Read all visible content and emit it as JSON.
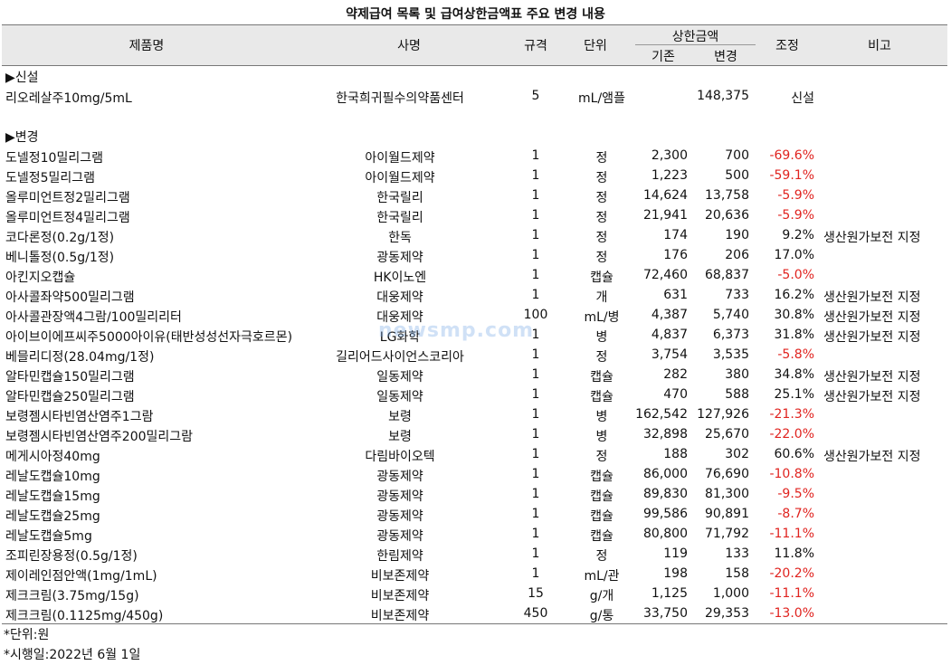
{
  "title": "약제급여 목록 및 급여상한금액표 주요 변경 내용",
  "header": {
    "product": "제품명",
    "company": "사명",
    "spec": "규격",
    "unit": "단위",
    "limit": "상한금액",
    "old": "기존",
    "new": "변경",
    "adj": "조정",
    "note": "비고"
  },
  "sections": {
    "new_label": "▶신설",
    "changed_label": "▶변경"
  },
  "new_rows": [
    {
      "name": "리오레살주10mg/5mL",
      "company": "한국희귀필수의약품센터",
      "spec": "5",
      "unit": "mL/앰플",
      "old": "",
      "new": "148,375",
      "adj": "신설",
      "note": ""
    }
  ],
  "rows": [
    {
      "name": "도넬정10밀리그램",
      "company": "아이월드제약",
      "spec": "1",
      "unit": "정",
      "old": "2,300",
      "new": "700",
      "adj": "-69.6%",
      "note": ""
    },
    {
      "name": "도넬정5밀리그램",
      "company": "아이월드제약",
      "spec": "1",
      "unit": "정",
      "old": "1,223",
      "new": "500",
      "adj": "-59.1%",
      "note": ""
    },
    {
      "name": "올루미언트정2밀리그램",
      "company": "한국릴리",
      "spec": "1",
      "unit": "정",
      "old": "14,624",
      "new": "13,758",
      "adj": "-5.9%",
      "note": ""
    },
    {
      "name": "올루미언트정4밀리그램",
      "company": "한국릴리",
      "spec": "1",
      "unit": "정",
      "old": "21,941",
      "new": "20,636",
      "adj": "-5.9%",
      "note": ""
    },
    {
      "name": "코다론정(0.2g/1정)",
      "company": "한독",
      "spec": "1",
      "unit": "정",
      "old": "174",
      "new": "190",
      "adj": "9.2%",
      "note": "생산원가보전 지정"
    },
    {
      "name": "베니톨정(0.5g/1정)",
      "company": "광동제약",
      "spec": "1",
      "unit": "정",
      "old": "176",
      "new": "206",
      "adj": "17.0%",
      "note": ""
    },
    {
      "name": "아킨지오캡슐",
      "company": "HK이노엔",
      "spec": "1",
      "unit": "캡슐",
      "old": "72,460",
      "new": "68,837",
      "adj": "-5.0%",
      "note": ""
    },
    {
      "name": "아사콜좌약500밀리그램",
      "company": "대웅제약",
      "spec": "1",
      "unit": "개",
      "old": "631",
      "new": "733",
      "adj": "16.2%",
      "note": "생산원가보전 지정"
    },
    {
      "name": "아사콜관장액4그람/100밀리리터",
      "company": "대웅제약",
      "spec": "100",
      "unit": "mL/병",
      "old": "4,387",
      "new": "5,740",
      "adj": "30.8%",
      "note": "생산원가보전 지정"
    },
    {
      "name": "아이브이에프씨주5000아이유(태반성성선자극호르몬)",
      "company": "LG화학",
      "spec": "1",
      "unit": "병",
      "old": "4,837",
      "new": "6,373",
      "adj": "31.8%",
      "note": "생산원가보전 지정"
    },
    {
      "name": "베믈리디정(28.04mg/1정)",
      "company": "길리어드사이언스코리아",
      "spec": "1",
      "unit": "정",
      "old": "3,754",
      "new": "3,535",
      "adj": "-5.8%",
      "note": ""
    },
    {
      "name": "알타민캡슐150밀리그램",
      "company": "일동제약",
      "spec": "1",
      "unit": "캡슐",
      "old": "282",
      "new": "380",
      "adj": "34.8%",
      "note": "생산원가보전 지정"
    },
    {
      "name": "알타민캡슐250밀리그램",
      "company": "일동제약",
      "spec": "1",
      "unit": "캡슐",
      "old": "470",
      "new": "588",
      "adj": "25.1%",
      "note": "생산원가보전 지정"
    },
    {
      "name": "보령젬시타빈염산염주1그람",
      "company": "보령",
      "spec": "1",
      "unit": "병",
      "old": "162,542",
      "new": "127,926",
      "adj": "-21.3%",
      "note": ""
    },
    {
      "name": "보령젬시타빈염산염주200밀리그람",
      "company": "보령",
      "spec": "1",
      "unit": "병",
      "old": "32,898",
      "new": "25,670",
      "adj": "-22.0%",
      "note": ""
    },
    {
      "name": "메게시아정40mg",
      "company": "다림바이오텍",
      "spec": "1",
      "unit": "정",
      "old": "188",
      "new": "302",
      "adj": "60.6%",
      "note": "생산원가보전 지정"
    },
    {
      "name": "레날도캡슐10mg",
      "company": "광동제약",
      "spec": "1",
      "unit": "캡슐",
      "old": "86,000",
      "new": "76,690",
      "adj": "-10.8%",
      "note": ""
    },
    {
      "name": "레날도캡슐15mg",
      "company": "광동제약",
      "spec": "1",
      "unit": "캡슐",
      "old": "89,830",
      "new": "81,300",
      "adj": "-9.5%",
      "note": ""
    },
    {
      "name": "레날도캡슐25mg",
      "company": "광동제약",
      "spec": "1",
      "unit": "캡슐",
      "old": "99,586",
      "new": "90,891",
      "adj": "-8.7%",
      "note": ""
    },
    {
      "name": "레날도캡슐5mg",
      "company": "광동제약",
      "spec": "1",
      "unit": "캡슐",
      "old": "80,800",
      "new": "71,792",
      "adj": "-11.1%",
      "note": ""
    },
    {
      "name": "조피린장용정(0.5g/1정)",
      "company": "한림제약",
      "spec": "1",
      "unit": "정",
      "old": "119",
      "new": "133",
      "adj": "11.8%",
      "note": ""
    },
    {
      "name": "제이레인점안액(1mg/1mL)",
      "company": "비보존제약",
      "spec": "1",
      "unit": "mL/관",
      "old": "198",
      "new": "158",
      "adj": "-20.2%",
      "note": ""
    },
    {
      "name": "제크크림(3.75mg/15g)",
      "company": "비보존제약",
      "spec": "15",
      "unit": "g/개",
      "old": "1,125",
      "new": "1,000",
      "adj": "-11.1%",
      "note": ""
    },
    {
      "name": "제크크림(0.1125mg/450g)",
      "company": "비보존제약",
      "spec": "450",
      "unit": "g/통",
      "old": "33,750",
      "new": "29,353",
      "adj": "-13.0%",
      "note": ""
    }
  ],
  "footnotes": [
    "*단위:원",
    "*시행일:2022년 6월 1일"
  ],
  "watermark": "newsmp.com",
  "colors": {
    "negative": "#e0231f",
    "header_bg": "#e9e9e9"
  }
}
